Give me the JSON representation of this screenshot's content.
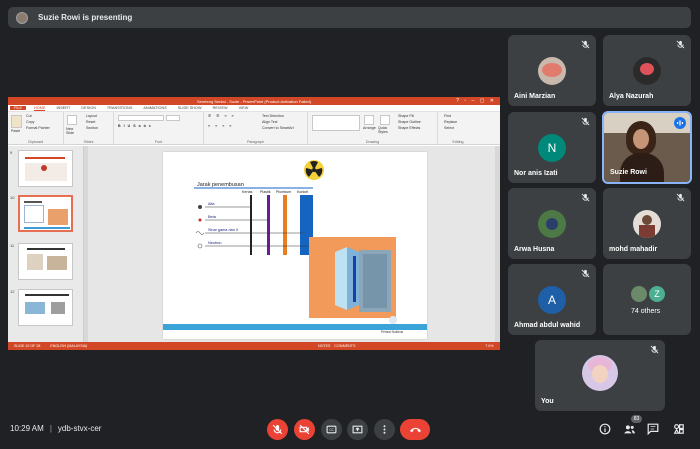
{
  "banner": {
    "text": "Suzie Rowi is presenting"
  },
  "presentation": {
    "window_title": "Semborg Sentai - Suzie - PowerPoint (Product Activation Failed)",
    "tabs": [
      "FILE",
      "HOME",
      "INSERT",
      "DESIGN",
      "TRANSITIONS",
      "ANIMATIONS",
      "SLIDE SHOW",
      "REVIEW",
      "VIEW"
    ],
    "active_tab": "HOME",
    "ribbon_groups": [
      "Clipboard",
      "Slides",
      "Font",
      "Paragraph",
      "Drawing",
      "Editing"
    ],
    "clipboard_items": [
      "Cut",
      "Copy",
      "Format Painter"
    ],
    "paste_label": "Paste",
    "slides_items": [
      "Layout",
      "Reset",
      "Section"
    ],
    "new_slide_label": "New Slide",
    "paragraph_items": [
      "Text Direction",
      "Align Text",
      "Convert to SmartArt"
    ],
    "drawing_items": [
      "Shape Fill",
      "Shape Outline",
      "Shape Effects"
    ],
    "arrange_label": "Arrange",
    "quick_styles_label": "Quick Styles",
    "editing_items": [
      "Find",
      "Replace",
      "Select"
    ],
    "thumb_numbers": [
      "9",
      "10",
      "11",
      "12"
    ],
    "slide": {
      "title": "Jarak penembusan",
      "columns": [
        "Kertas",
        "Plastik",
        "Plumbum",
        "Konkrit"
      ],
      "rays": [
        "Alfa",
        "Beta",
        "Sinar gama dan X",
        "Neutron"
      ],
      "footnote": "Perisai Nukleus"
    },
    "status": {
      "left": "SLIDE 10 OF 28",
      "lang": "ENGLISH (MALAYSIA)",
      "notes": "NOTES",
      "comments": "COMMENTS",
      "zoom": "74%"
    }
  },
  "participants": [
    {
      "name": "Aini Marzian"
    },
    {
      "name": "Alya Nazurah"
    },
    {
      "name": "Nor anis Izati",
      "initial": "N",
      "color": "#00897b"
    },
    {
      "name": "Suzie Rowi"
    },
    {
      "name": "Arwa Husna"
    },
    {
      "name": "mohd mahadir"
    },
    {
      "name": "Ahmad abdul wahid",
      "initial": "A",
      "color": "#1e5fa8"
    },
    {
      "name": "74 others",
      "initial": "Z",
      "color": "#4caf91"
    },
    {
      "name": "You"
    }
  ],
  "bottom": {
    "time": "10:29 AM",
    "separator": "|",
    "meeting_code": "ydb-stvx-cer",
    "people_count": "83"
  },
  "colors": {
    "end_call": "#ea4335",
    "active_border": "#8ab4f8",
    "powerpoint": "#d24726"
  }
}
